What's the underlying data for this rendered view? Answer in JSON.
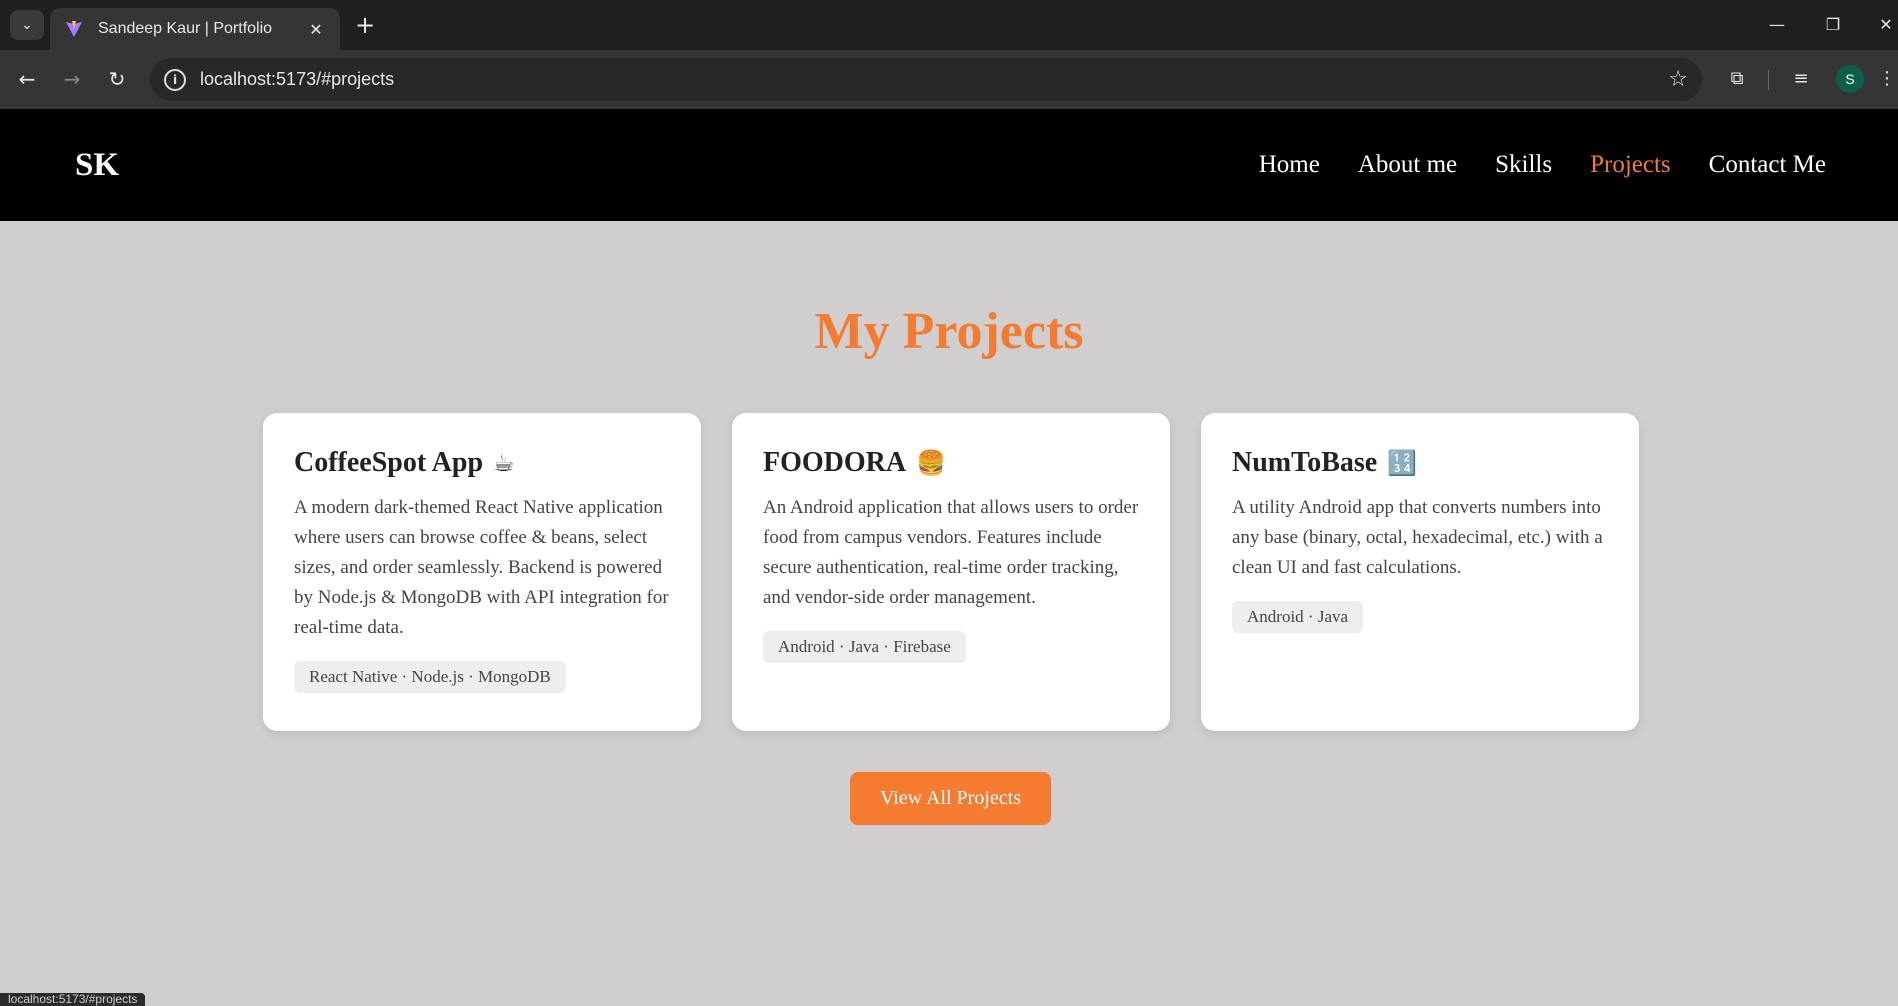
{
  "browser": {
    "tab_title": "Sandeep Kaur | Portfolio",
    "url": "localhost:5173/#projects",
    "profile_initial": "S",
    "status_url": "localhost:5173/#projects"
  },
  "header": {
    "logo": "SK",
    "nav": [
      {
        "label": "Home",
        "active": false
      },
      {
        "label": "About me",
        "active": false
      },
      {
        "label": "Skills",
        "active": false
      },
      {
        "label": "Projects",
        "active": true
      },
      {
        "label": "Contact Me",
        "active": false
      }
    ]
  },
  "projects": {
    "title": "My Projects",
    "cards": [
      {
        "title": "CoffeeSpot App",
        "emoji": "☕",
        "description": "A modern dark-themed React Native application where users can browse coffee & beans, select sizes, and order seamlessly. Backend is powered by Node.js & MongoDB with API integration for real-time data.",
        "tags": "React Native · Node.js · MongoDB"
      },
      {
        "title": "FOODORA",
        "emoji": "🍔",
        "description": "An Android application that allows users to order food from campus vendors. Features include secure authentication, real-time order tracking, and vendor-side order management.",
        "tags": "Android · Java · Firebase"
      },
      {
        "title": "NumToBase",
        "emoji": "🔢",
        "description": "A utility Android app that converts numbers into any base (binary, octal, hexadecimal, etc.) with a clean UI and fast calculations.",
        "tags": "Android · Java"
      }
    ],
    "cta_label": "View All Projects"
  },
  "colors": {
    "accent": "#f47b30",
    "page_bg": "#d0cecf",
    "header_bg": "#000000"
  }
}
